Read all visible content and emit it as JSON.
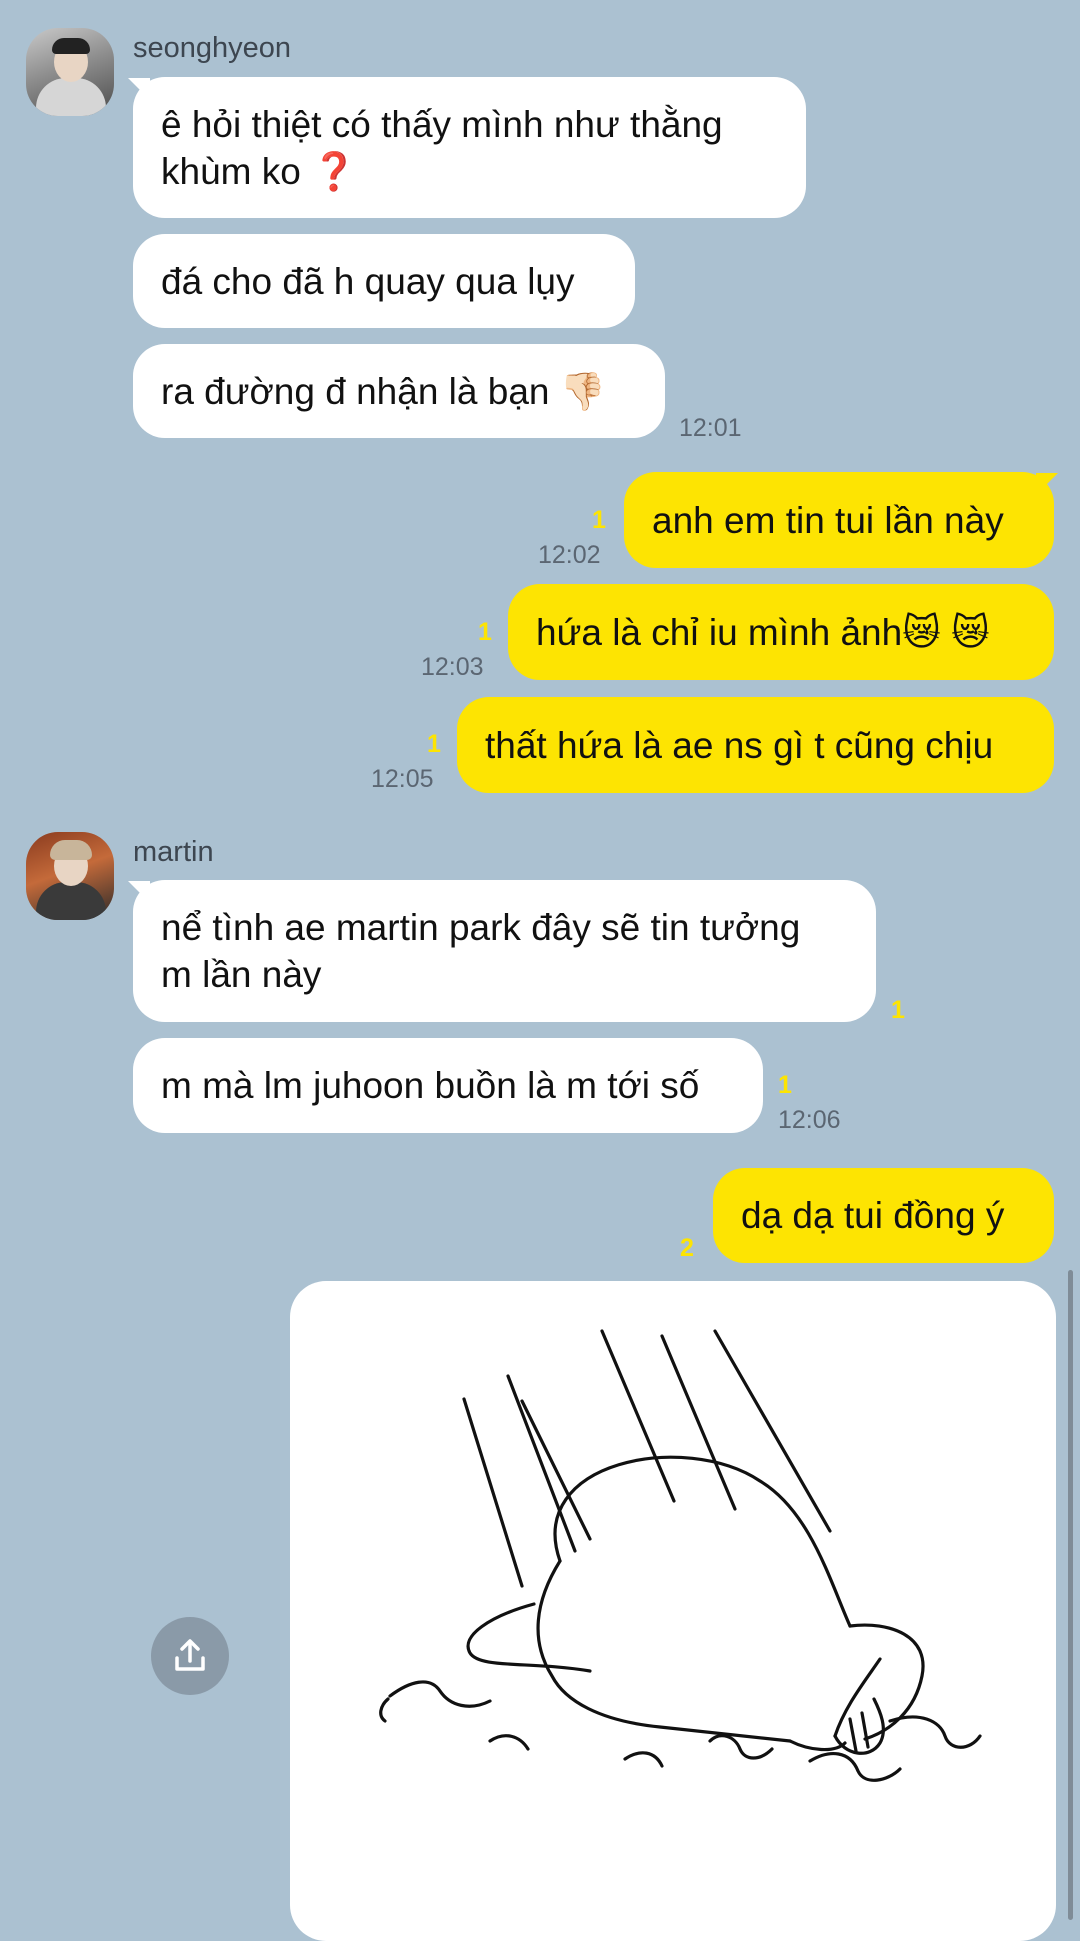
{
  "messages": {
    "group1": {
      "sender": "seonghyeon",
      "m1_line1": "ê hỏi thiệt có thấy mình như thằng",
      "m1_line2": "khùm ko",
      "m1_emoji": "❓",
      "m2": "đá cho đã h quay qua lụy",
      "m3": "ra đường đ nhận là bạn",
      "m3_emoji": "👎🏻",
      "time": "12:01"
    },
    "out1": {
      "text": "anh em tin tui lần này",
      "unread": "1",
      "time": "12:02"
    },
    "out2": {
      "text": "hứa là chỉ iu mình ảnh",
      "emoji": "😿 😿",
      "unread": "1",
      "time": "12:03"
    },
    "out3": {
      "text": "thất hứa là ae ns gì t cũng chịu",
      "unread": "1",
      "time": "12:05"
    },
    "group2": {
      "sender": "martin",
      "m1_line1": "nể tình ae martin park đây sẽ tin tưởng",
      "m1_line2": "m lần này",
      "m1_unread": "1",
      "m2": "m mà lm juhoon buồn là m tới số",
      "m2_unread": "1",
      "time": "12:06"
    },
    "out4": {
      "text": "dạ dạ tui đồng ý",
      "unread": "2"
    }
  },
  "icons": {
    "share": "upload-share-icon",
    "image": "bowing-figure-sticker"
  },
  "colors": {
    "background": "#abc1d1",
    "incoming": "#ffffff",
    "outgoing": "#fde402",
    "unread": "#fde402"
  }
}
